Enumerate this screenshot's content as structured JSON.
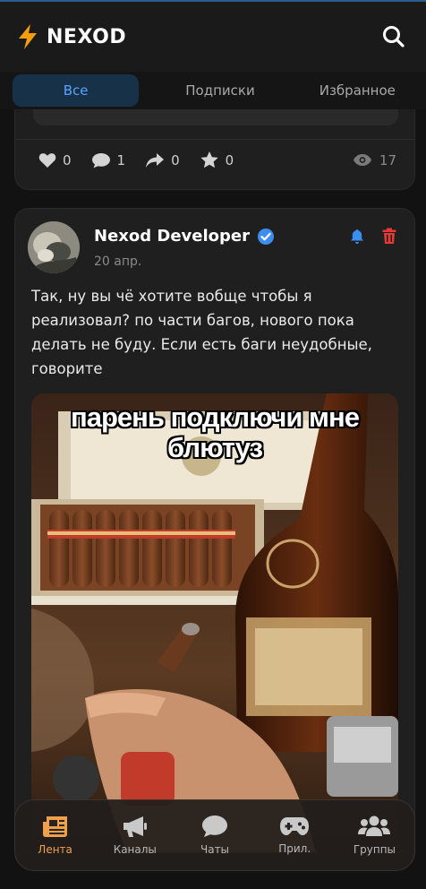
{
  "header": {
    "app_name": "NEXOD",
    "logo_icon": "lightning-bolt-icon",
    "search_icon": "search-icon"
  },
  "tabs": [
    {
      "label": "Все",
      "active": true
    },
    {
      "label": "Подписки",
      "active": false
    },
    {
      "label": "Избранное",
      "active": false
    }
  ],
  "previous_post": {
    "stats": {
      "likes": "0",
      "comments": "1",
      "reposts": "0",
      "favorites": "0",
      "views": "17"
    }
  },
  "post": {
    "author": "Nexod Developer",
    "verified": true,
    "date": "20 апр.",
    "text": "Так, ну вы чё хотите вобще чтобы я реализовал? по части багов, нового пока делать не буду. Если есть баги неудобные, говорите",
    "image_caption_line1": "парень подключи мне",
    "image_caption_line2": "блютуз"
  },
  "bottom_nav": [
    {
      "label": "Лента",
      "icon": "newspaper-icon",
      "active": true
    },
    {
      "label": "Каналы",
      "icon": "megaphone-icon",
      "active": false
    },
    {
      "label": "Чаты",
      "icon": "chat-bubble-icon",
      "active": false
    },
    {
      "label": "Прил.",
      "icon": "gamepad-icon",
      "active": false
    },
    {
      "label": "Группы",
      "icon": "users-icon",
      "active": false
    }
  ],
  "colors": {
    "accent_blue": "#5aa2ff",
    "accent_orange": "#f0a04b",
    "delete_red": "#e53935",
    "bolt_orange": "#f59e0b"
  }
}
